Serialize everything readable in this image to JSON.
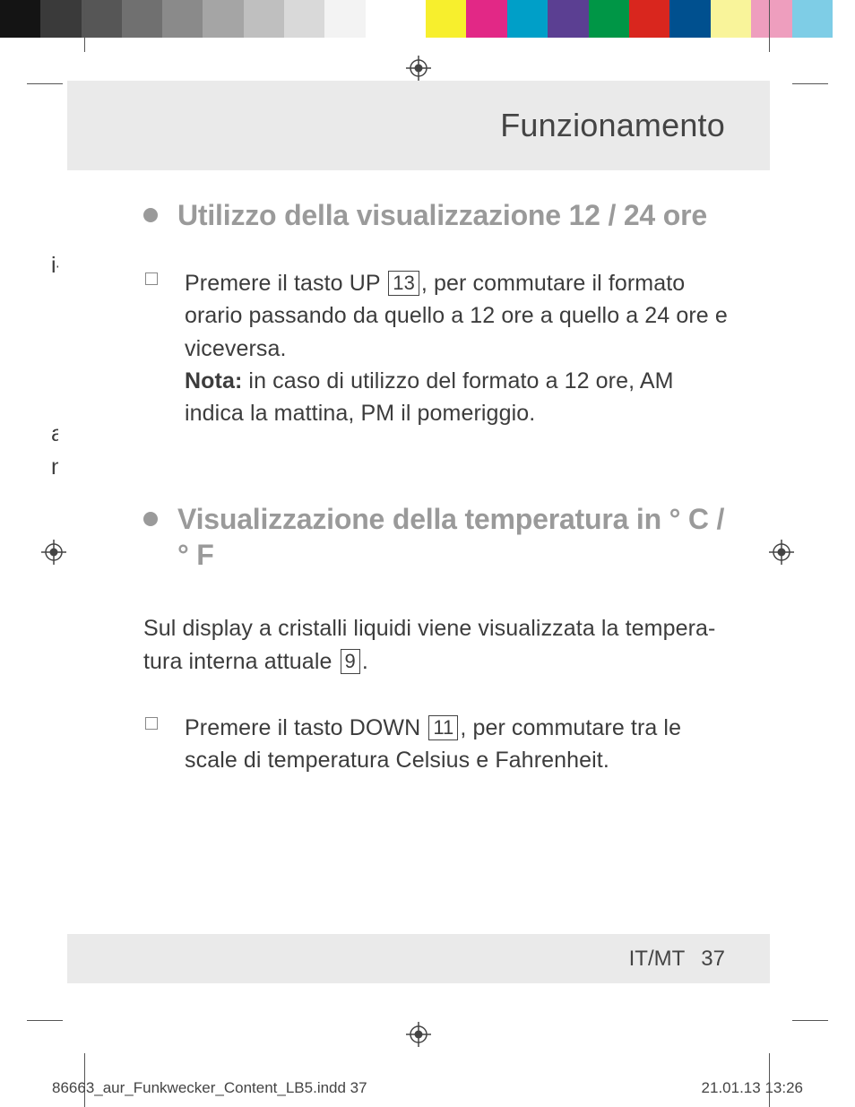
{
  "colorbar": {
    "grays": [
      "#141414",
      "#3a3a3a",
      "#565656",
      "#707070",
      "#8a8a8a",
      "#a5a5a5",
      "#bfbfbf",
      "#d9d9d9",
      "#f3f3f3",
      "#ffffff"
    ],
    "colors": [
      "#f7ef2d",
      "#e22886",
      "#009fc8",
      "#5b3f92",
      "#009646",
      "#d9261e",
      "#00508f",
      "#f9f49a",
      "#ee9ebe",
      "#7ecde6"
    ]
  },
  "header": {
    "title": "Funzionamento"
  },
  "section1": {
    "heading": "Utilizzo della visualizzazione 12 / 24 ore",
    "item_pre": "Premere il tasto UP ",
    "item_ref": "13",
    "item_post": ", per commutare il formato orario passando da quello a 12 ore a quello a 24 ore e viceversa.",
    "note_label": "Nota:",
    "note_text": " in caso di utilizzo del formato a 12 ore, AM indica la mattina, PM il pomeriggio."
  },
  "section2": {
    "heading": "Visualizzazione della temperatura in ° C / ° F",
    "para_pre": "Sul display a cristalli liquidi viene visualizzata la tempera-tura interna attuale ",
    "para_ref": "9",
    "para_post": ".",
    "item_pre": "Premere il tasto DOWN ",
    "item_ref": "11",
    "item_post": ", per commutare tra le scale di temperatura Celsius e Fahrenheit."
  },
  "footer": {
    "lang": "IT/MT",
    "page": "37"
  },
  "imprint": {
    "file": "86663_aur_Funkwecker_Content_LB5.indd   37",
    "date": "21.01.13   13:26"
  },
  "bleed": {
    "b1": "i-",
    "b2": "a",
    "b3": "n"
  }
}
